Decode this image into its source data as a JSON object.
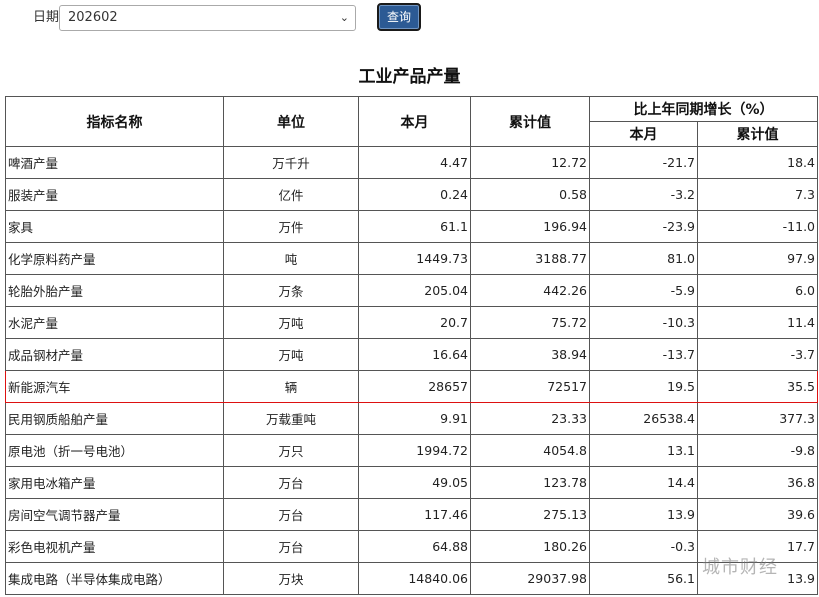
{
  "filter": {
    "date_label": "日期",
    "date_value": "202602",
    "query_label": "查询"
  },
  "title": "工业产品产量",
  "headers": {
    "name": "指标名称",
    "unit": "单位",
    "month": "本月",
    "cumulative": "累计值",
    "growth": "比上年同期增长（%）",
    "growth_month": "本月",
    "growth_cumulative": "累计值"
  },
  "rows": [
    {
      "name": "啤酒产量",
      "unit": "万千升",
      "month": "4.47",
      "cum": "12.72",
      "gm": "-21.7",
      "gc": "18.4"
    },
    {
      "name": "服装产量",
      "unit": "亿件",
      "month": "0.24",
      "cum": "0.58",
      "gm": "-3.2",
      "gc": "7.3"
    },
    {
      "name": "家具",
      "unit": "万件",
      "month": "61.1",
      "cum": "196.94",
      "gm": "-23.9",
      "gc": "-11.0"
    },
    {
      "name": "化学原料药产量",
      "unit": "吨",
      "month": "1449.73",
      "cum": "3188.77",
      "gm": "81.0",
      "gc": "97.9"
    },
    {
      "name": "轮胎外胎产量",
      "unit": "万条",
      "month": "205.04",
      "cum": "442.26",
      "gm": "-5.9",
      "gc": "6.0"
    },
    {
      "name": "水泥产量",
      "unit": "万吨",
      "month": "20.7",
      "cum": "75.72",
      "gm": "-10.3",
      "gc": "11.4"
    },
    {
      "name": "成品钢材产量",
      "unit": "万吨",
      "month": "16.64",
      "cum": "38.94",
      "gm": "-13.7",
      "gc": "-3.7"
    },
    {
      "name": "新能源汽车",
      "unit": "辆",
      "month": "28657",
      "cum": "72517",
      "gm": "19.5",
      "gc": "35.5"
    },
    {
      "name": "民用钢质船舶产量",
      "unit": "万载重吨",
      "month": "9.91",
      "cum": "23.33",
      "gm": "26538.4",
      "gc": "377.3"
    },
    {
      "name": "原电池（折一号电池）",
      "unit": "万只",
      "month": "1994.72",
      "cum": "4054.8",
      "gm": "13.1",
      "gc": "-9.8"
    },
    {
      "name": "家用电冰箱产量",
      "unit": "万台",
      "month": "49.05",
      "cum": "123.78",
      "gm": "14.4",
      "gc": "36.8"
    },
    {
      "name": "房间空气调节器产量",
      "unit": "万台",
      "month": "117.46",
      "cum": "275.13",
      "gm": "13.9",
      "gc": "39.6"
    },
    {
      "name": "彩色电视机产量",
      "unit": "万台",
      "month": "64.88",
      "cum": "180.26",
      "gm": "-0.3",
      "gc": "17.7"
    },
    {
      "name": "集成电路（半导体集成电路）",
      "unit": "万块",
      "month": "14840.06",
      "cum": "29037.98",
      "gm": "56.1",
      "gc": "13.9"
    }
  ],
  "highlighted_row": "新能源汽车",
  "watermark": "城市财经"
}
